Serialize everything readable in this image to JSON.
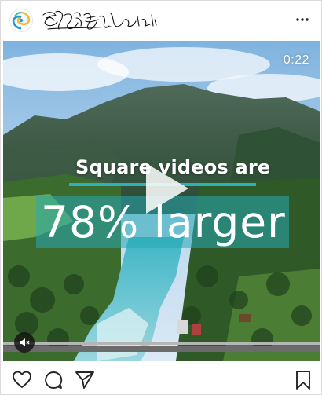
{
  "header": {
    "avatar_icon": "avatar-swirl-logo",
    "username_icon": "handwritten-username-logo",
    "more_icon": "more-options-icon"
  },
  "video": {
    "timestamp": "0:22",
    "headline_line1": "Square videos are",
    "headline_line2": "78% larger",
    "play_icon": "play-icon",
    "mute_icon": "muted-speaker-icon",
    "accent_color": "#2cb0bc"
  },
  "actions": {
    "like_icon": "heart-icon",
    "comment_icon": "comment-icon",
    "share_icon": "share-icon",
    "save_icon": "bookmark-icon"
  }
}
